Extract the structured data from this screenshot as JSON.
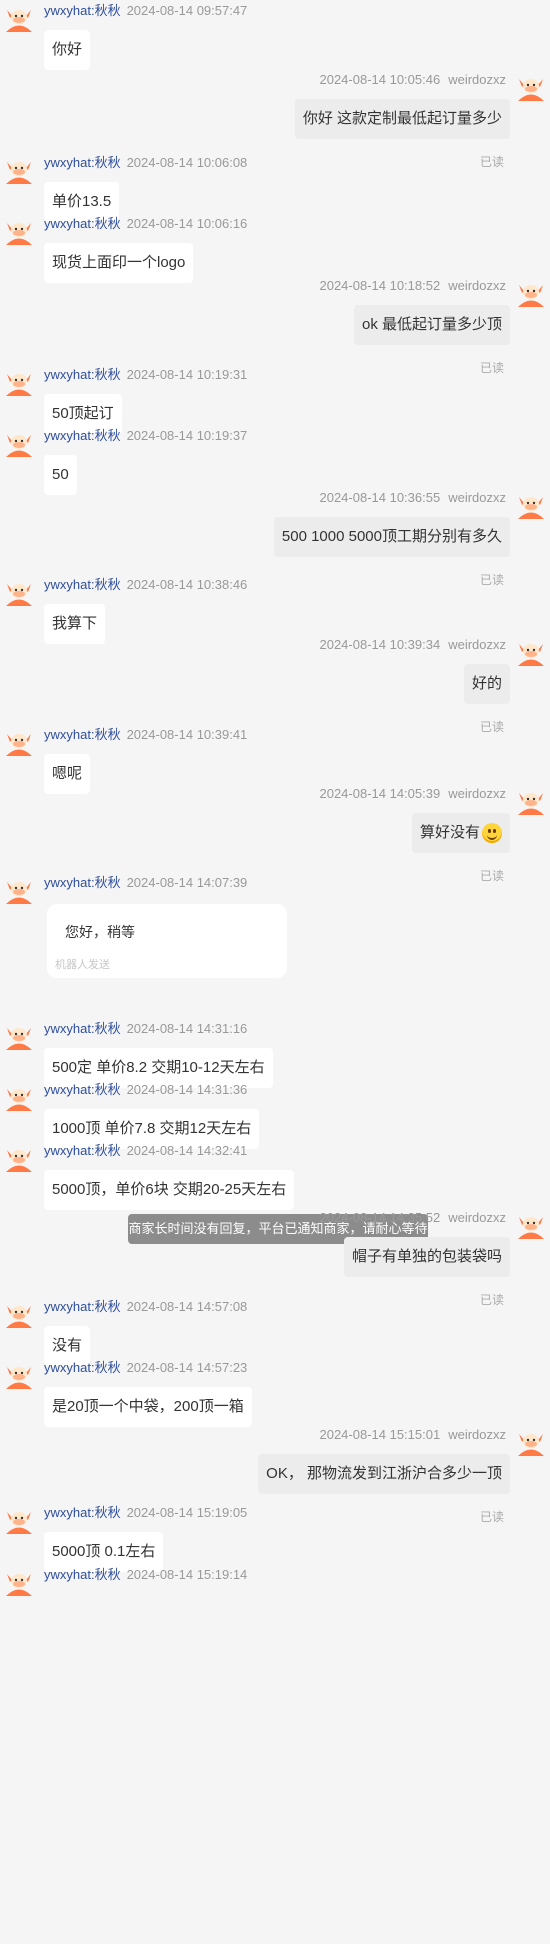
{
  "messages": [
    {
      "side": "left",
      "name": "ywxyhat:秋秋",
      "time": "2024-08-14 09:57:47",
      "text": "你好"
    },
    {
      "side": "right",
      "name": "weirdozxz",
      "time": "2024-08-14 10:05:46",
      "text": "你好 这款定制最低起订量多少",
      "status": "已读"
    },
    {
      "side": "left",
      "name": "ywxyhat:秋秋",
      "time": "2024-08-14 10:06:08",
      "text": "单价13.5"
    },
    {
      "side": "left",
      "name": "ywxyhat:秋秋",
      "time": "2024-08-14 10:06:16",
      "text": "现货上面印一个logo"
    },
    {
      "side": "right",
      "name": "weirdozxz",
      "time": "2024-08-14 10:18:52",
      "text": "ok 最低起订量多少顶",
      "status": "已读"
    },
    {
      "side": "left",
      "name": "ywxyhat:秋秋",
      "time": "2024-08-14 10:19:31",
      "text": "50顶起订"
    },
    {
      "side": "left",
      "name": "ywxyhat:秋秋",
      "time": "2024-08-14 10:19:37",
      "text": "50"
    },
    {
      "side": "right",
      "name": "weirdozxz",
      "time": "2024-08-14 10:36:55",
      "text": "500 1000 5000顶工期分别有多久",
      "status": "已读"
    },
    {
      "side": "left",
      "name": "ywxyhat:秋秋",
      "time": "2024-08-14 10:38:46",
      "text": "我算下"
    },
    {
      "side": "right",
      "name": "weirdozxz",
      "time": "2024-08-14 10:39:34",
      "text": "好的",
      "status": "已读"
    },
    {
      "side": "left",
      "name": "ywxyhat:秋秋",
      "time": "2024-08-14 10:39:41",
      "text": "嗯呢"
    },
    {
      "side": "right",
      "name": "weirdozxz",
      "time": "2024-08-14 14:05:39",
      "text": "算好没有",
      "emoji": "smile-emoji",
      "status": "已读"
    },
    {
      "side": "left",
      "name": "ywxyhat:秋秋",
      "time": "2024-08-14 14:07:39",
      "card": true,
      "text": "您好，稍等",
      "subtext": "机器人发送"
    },
    {
      "side": "left",
      "name": "ywxyhat:秋秋",
      "time": "2024-08-14 14:31:16",
      "text": "500定 单价8.2 交期10-12天左右"
    },
    {
      "side": "left",
      "name": "ywxyhat:秋秋",
      "time": "2024-08-14 14:31:36",
      "text": "1000顶 单价7.8 交期12天左右"
    },
    {
      "side": "left",
      "name": "ywxyhat:秋秋",
      "time": "2024-08-14 14:32:41",
      "text": "5000顶，单价6块 交期20-25天左右"
    },
    {
      "side": "right",
      "name": "weirdozxz",
      "time": "2024-08-14 14:35:52",
      "text": "帽子有单独的包装袋吗",
      "status": "已读"
    },
    {
      "side": "left",
      "name": "ywxyhat:秋秋",
      "time": "2024-08-14 14:57:08",
      "text": "没有"
    },
    {
      "side": "left",
      "name": "ywxyhat:秋秋",
      "time": "2024-08-14 14:57:23",
      "text": "是20顶一个中袋，200顶一箱"
    },
    {
      "side": "right",
      "name": "weirdozxz",
      "time": "2024-08-14 15:15:01",
      "text": "OK，  那物流发到江浙沪合多少一顶",
      "status": "已读"
    },
    {
      "side": "left",
      "name": "ywxyhat:秋秋",
      "time": "2024-08-14 15:19:05",
      "text": "5000顶  0.1左右"
    },
    {
      "side": "left",
      "name": "ywxyhat:秋秋",
      "time": "2024-08-14 15:19:14",
      "text": ""
    }
  ],
  "system_notice": "商家长时间没有回复，平台已通知商家，请耐心等待",
  "colors": {
    "name": "#2f4f9c",
    "meta": "#999999",
    "bubble_left": "#ffffff",
    "bubble_right": "#ececec",
    "background": "#f5f5f5",
    "avatar": "#ff7a45"
  }
}
